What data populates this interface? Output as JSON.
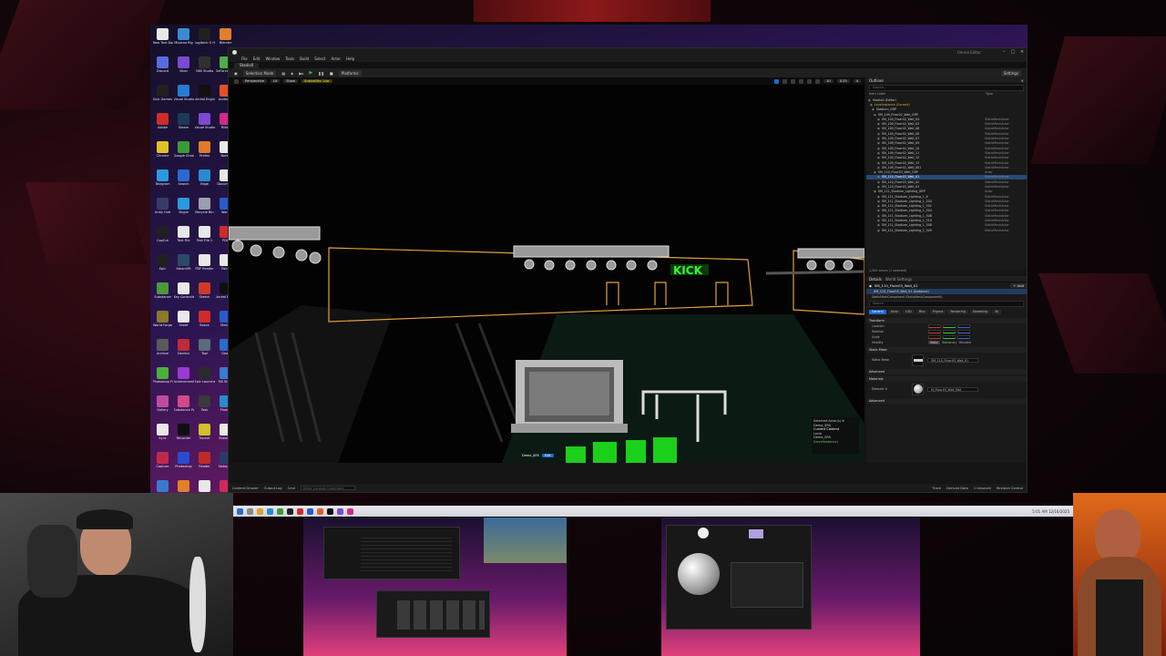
{
  "desktop": {
    "icons": [
      {
        "label": "New Text Document",
        "color": "#e8e8e8"
      },
      {
        "label": "Mixamo Rig",
        "color": "#3a8ad0"
      },
      {
        "label": "Logitech G Hub",
        "color": "#202020"
      },
      {
        "label": "Blender",
        "color": "#e0802a"
      },
      {
        "label": "Discord",
        "color": "#5a6ae0"
      },
      {
        "label": "Viber",
        "color": "#7a4ad0"
      },
      {
        "label": "OBS Studio",
        "color": "#303030"
      },
      {
        "label": "GeForce Experience",
        "color": "#4ab04a"
      },
      {
        "label": "Epic Games",
        "color": "#202020"
      },
      {
        "label": "Visual Studio Code",
        "color": "#2a7ad0"
      },
      {
        "label": "Unreal Engine",
        "color": "#101010"
      },
      {
        "label": "Audacity",
        "color": "#e0502a"
      },
      {
        "label": "Adobe",
        "color": "#d02a2a"
      },
      {
        "label": "Steam",
        "color": "#1a3a5a"
      },
      {
        "label": "Visual Studio",
        "color": "#7a4ad0"
      },
      {
        "label": "Rider",
        "color": "#d02a8a"
      },
      {
        "label": "Chrome",
        "color": "#e0c02a"
      },
      {
        "label": "Google Chrome",
        "color": "#3a9a3a"
      },
      {
        "label": "Firefox",
        "color": "#e07a2a"
      },
      {
        "label": "Notes",
        "color": "#e8e8e8"
      },
      {
        "label": "Telegram",
        "color": "#2a9ae0"
      },
      {
        "label": "Search",
        "color": "#2a6ad0"
      },
      {
        "label": "Edge",
        "color": "#2a8ad0"
      },
      {
        "label": "Document",
        "color": "#e8e8e8"
      },
      {
        "label": "Unity Hub",
        "color": "#3a3a6a"
      },
      {
        "label": "Skype",
        "color": "#2a9ae0"
      },
      {
        "label": "Recycle Bin",
        "color": "#9aa0b0"
      },
      {
        "label": "Word",
        "color": "#2a5ad0"
      },
      {
        "label": "CapCut",
        "color": "#202020"
      },
      {
        "label": "Text File",
        "color": "#e8e8e8"
      },
      {
        "label": "Text File 2",
        "color": "#e8e8e8"
      },
      {
        "label": "PDF",
        "color": "#d02a2a"
      },
      {
        "label": "Epic",
        "color": "#202020"
      },
      {
        "label": "SteamVR",
        "color": "#2a4a6a"
      },
      {
        "label": "PDF Reader",
        "color": "#e8e8e8"
      },
      {
        "label": "Paint",
        "color": "#e8e8e8"
      },
      {
        "label": "Substance",
        "color": "#4a9a3a"
      },
      {
        "label": "Key Controller",
        "color": "#e8e8e8"
      },
      {
        "label": "Sketch",
        "color": "#d03a2a"
      },
      {
        "label": "Unreal Engine 5",
        "color": "#101010"
      },
      {
        "label": "World Forge",
        "color": "#8a7a2a"
      },
      {
        "label": "Sheet",
        "color": "#e8e8e8"
      },
      {
        "label": "Brave",
        "color": "#d02a2a"
      },
      {
        "label": "Media",
        "color": "#2a5ad0"
      },
      {
        "label": "Archive",
        "color": "#5a5a5a"
      },
      {
        "label": "Davinci",
        "color": "#c02a3a"
      },
      {
        "label": "Tool",
        "color": "#5a6a7a"
      },
      {
        "label": "Gear",
        "color": "#2a6ad0"
      },
      {
        "label": "Photoshop Files",
        "color": "#4ab03a"
      },
      {
        "label": "Achievement",
        "color": "#9a3ad0"
      },
      {
        "label": "Epic Launcher",
        "color": "#2a2a2a"
      },
      {
        "label": "MS Store",
        "color": "#3a7ad0"
      },
      {
        "label": "Gallery",
        "color": "#c04aa0"
      },
      {
        "label": "Substance Painter",
        "color": "#d04a8a"
      },
      {
        "label": "Task",
        "color": "#3a3a3a"
      },
      {
        "label": "Photos",
        "color": "#2a8ad0"
      },
      {
        "label": "Sync",
        "color": "#e8e8e8"
      },
      {
        "label": "Recorder",
        "color": "#101010"
      },
      {
        "label": "Tracker",
        "color": "#d0c02a"
      },
      {
        "label": "Browser",
        "color": "#e8e8e8"
      },
      {
        "label": "Capture",
        "color": "#c02a4a"
      },
      {
        "label": "Photoshop",
        "color": "#2a4ad0"
      },
      {
        "label": "Reader",
        "color": "#c02a2a"
      },
      {
        "label": "Notepad",
        "color": "#2a3a6a"
      },
      {
        "label": "App",
        "color": "#3a7ad0"
      },
      {
        "label": "Blender 4",
        "color": "#e0802a"
      },
      {
        "label": "Editor",
        "color": "#e8e8e8"
      },
      {
        "label": "Shortcut",
        "color": "#d02a5a"
      }
    ]
  },
  "ue": {
    "title": "Unreal Editor",
    "project": "Unreal Editor",
    "menus": [
      "File",
      "Edit",
      "Window",
      "Tools",
      "Build",
      "Select",
      "Actor",
      "Help"
    ],
    "level_tab": "Stadio0",
    "toolbar": {
      "mode": "Selection Mode",
      "platforms": "Platforms",
      "settings": "Settings"
    },
    "viewport": {
      "perspective": "Perspective",
      "lit": "Lit",
      "show": "Show",
      "scalability": "Scalability: Low",
      "fov": "0.25",
      "grid": "10",
      "speed": "4",
      "context": {
        "selected": "Selected Actor(s) in",
        "level_name": "Demo_$RS",
        "current": "Current Content",
        "level_label": "Level",
        "level": "Demo_0RS",
        "persistent": "(LevelInstance)"
      },
      "badge_level": "Demo_$RS",
      "badge_tag": "Edit"
    },
    "outliner": {
      "title": "Outliner",
      "search": "Search...",
      "col_label": "Item Label",
      "col_type": "Type",
      "rows": [
        {
          "name": "Stadio0 (Editor)",
          "type": "",
          "indent": 2,
          "cls": ""
        },
        {
          "name": "LevelInstance (Current)",
          "type": "",
          "indent": 4,
          "cls": "lvl"
        },
        {
          "name": "Stadium_GRP",
          "type": "",
          "indent": 6,
          "cls": ""
        },
        {
          "name": "SM_109_Floor02_Wall_GRP",
          "type": "",
          "indent": 8,
          "cls": ""
        },
        {
          "name": "SM_109_Floor02_Wall_04",
          "type": "StaticMeshActor",
          "indent": 12,
          "cls": ""
        },
        {
          "name": "SM_109_Floor02_Wall_05",
          "type": "StaticMeshActor",
          "indent": 12,
          "cls": ""
        },
        {
          "name": "SM_109_Floor02_Wall_06",
          "type": "StaticMeshActor",
          "indent": 12,
          "cls": ""
        },
        {
          "name": "SM_109_Floor02_Wall_08",
          "type": "StaticMeshActor",
          "indent": 12,
          "cls": ""
        },
        {
          "name": "SM_109_Floor02_Wall_07",
          "type": "StaticMeshActor",
          "indent": 12,
          "cls": ""
        },
        {
          "name": "SM_109_Floor02_Wall_09",
          "type": "StaticMeshActor",
          "indent": 12,
          "cls": ""
        },
        {
          "name": "SM_109_Floor02_Wall_10",
          "type": "StaticMeshActor",
          "indent": 12,
          "cls": ""
        },
        {
          "name": "SM_109_Floor02_Wall_11",
          "type": "StaticMeshActor",
          "indent": 12,
          "cls": ""
        },
        {
          "name": "SM_109_Floor02_Wall_12",
          "type": "StaticMeshActor",
          "indent": 12,
          "cls": ""
        },
        {
          "name": "SM_109_Floor02_Wall_13",
          "type": "StaticMeshActor",
          "indent": 12,
          "cls": ""
        },
        {
          "name": "SM_109_Floor02_Wall_001",
          "type": "StaticMeshActor",
          "indent": 12,
          "cls": ""
        },
        {
          "name": "SM_110_Floor03_Wall_GRP",
          "type": "Actor",
          "indent": 8,
          "cls": ""
        },
        {
          "name": "SM_110_Floor03_Wall_01",
          "type": "StaticMeshActor",
          "indent": 12,
          "cls": "sel"
        },
        {
          "name": "SM_110_Floor03_Wall_02",
          "type": "StaticMeshActor",
          "indent": 12,
          "cls": ""
        },
        {
          "name": "SM_110_Floor03_Wall_03",
          "type": "StaticMeshActor",
          "indent": 12,
          "cls": ""
        },
        {
          "name": "SM_111_Stadium_Lighting_GRP",
          "type": "Actor",
          "indent": 8,
          "cls": ""
        },
        {
          "name": "SM_111_Stadium_Lighting_1_8",
          "type": "StaticMeshActor",
          "indent": 12,
          "cls": ""
        },
        {
          "name": "SM_111_Stadium_Lighting_1_204",
          "type": "StaticMeshActor",
          "indent": 12,
          "cls": ""
        },
        {
          "name": "SM_111_Stadium_Lighting_1_302",
          "type": "StaticMeshActor",
          "indent": 12,
          "cls": ""
        },
        {
          "name": "SM_111_Stadium_Lighting_1_304",
          "type": "StaticMeshActor",
          "indent": 12,
          "cls": ""
        },
        {
          "name": "SM_111_Stadium_Lighting_1_306",
          "type": "StaticMeshActor",
          "indent": 12,
          "cls": ""
        },
        {
          "name": "SM_111_Stadium_Lighting_1_310",
          "type": "StaticMeshActor",
          "indent": 12,
          "cls": ""
        },
        {
          "name": "SM_111_Stadium_Lighting_1_308",
          "type": "StaticMeshActor",
          "indent": 12,
          "cls": ""
        },
        {
          "name": "SM_111_Stadium_Lighting_1_309",
          "type": "StaticMeshActor",
          "indent": 12,
          "cls": ""
        }
      ],
      "status": "1,305 actors (1 selected)"
    },
    "details": {
      "title": "Details",
      "world_settings": "World Settings",
      "selected": "SM_110_Floor03_Wall_01",
      "add": "+ Add",
      "instance": "SM_110_Floor03_Wall_01 (Instance)",
      "component": "StaticMeshComponent (StaticMeshComponent0)",
      "search": "Search",
      "tabs": [
        "General",
        "Actor",
        "LOD",
        "Misc",
        "Physics",
        "Rendering",
        "Streaming",
        "All"
      ],
      "transform": "Transform",
      "location": "Location",
      "rotation": "Rotation",
      "scale": "Scale",
      "mobility": "Mobility",
      "mob_opts": [
        "Static",
        "Stationary",
        "Movable"
      ],
      "static_mesh_section": "Static Mesh",
      "static_mesh_label": "Static Mesh",
      "static_mesh_value": "SM_110_Floor03_Wall_01",
      "advanced": "Advanced",
      "materials": "Materials",
      "element0": "Element 0",
      "material_value": "M_Floor03_Wall_Mat",
      "advanced2": "Advanced"
    },
    "statusbar": {
      "drawer": "Content Drawer",
      "output": "Output Log",
      "cmd": "Cmd",
      "cmd_placeholder": "Enter Console Command",
      "trace": "Trace",
      "derived": "Derived Data",
      "unsaved": "1 Unsaved",
      "revision": "Revision Control"
    }
  },
  "taskbar": {
    "tray_time": "5:01 AM",
    "tray_date": "12/16/2025"
  }
}
